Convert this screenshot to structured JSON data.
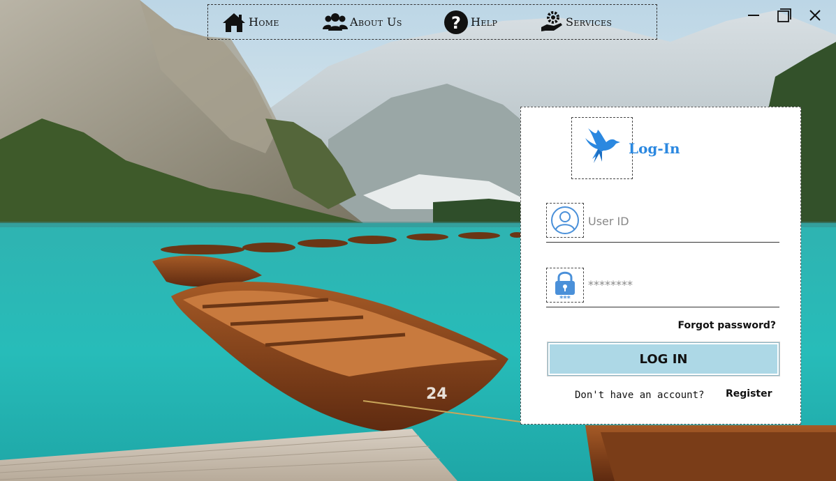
{
  "nav": {
    "items": [
      {
        "label": "Home",
        "icon": "home-icon"
      },
      {
        "label": "About Us",
        "icon": "users-icon"
      },
      {
        "label": "Help",
        "icon": "question-icon"
      },
      {
        "label": "Services",
        "icon": "service-gear-hand-icon"
      }
    ]
  },
  "window": {
    "minimize": "minimize-icon",
    "maximize": "maximize-icon",
    "close": "close-icon"
  },
  "login": {
    "title": "Log-In",
    "logo_icon": "bird-icon",
    "user_placeholder": "User ID",
    "password_placeholder": "********",
    "forgot": "Forgot password?",
    "button": "LOG IN",
    "no_account": "Don't have an account?",
    "register": "Register",
    "colors": {
      "accent": "#2b88e0",
      "button": "#add8e6"
    }
  }
}
